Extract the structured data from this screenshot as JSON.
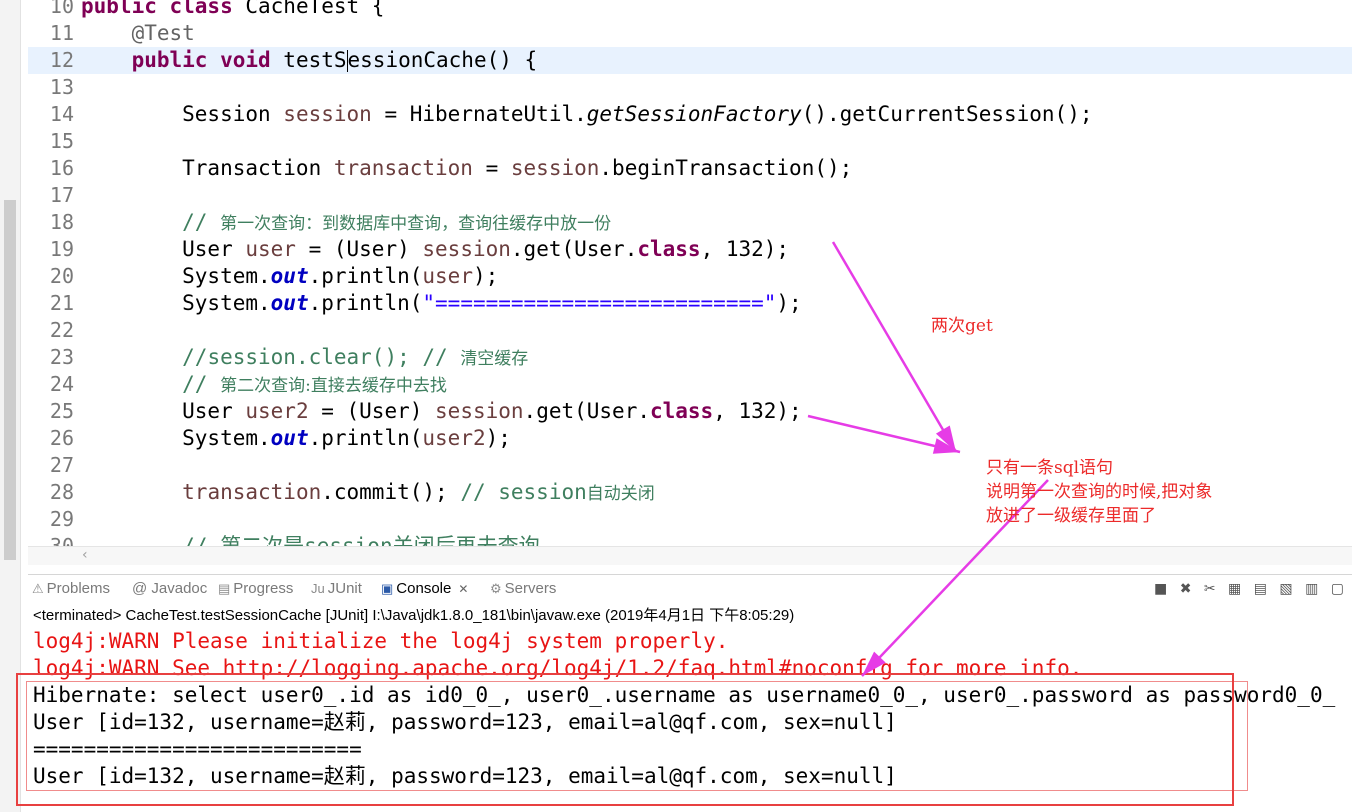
{
  "editor": {
    "lines": [
      {
        "no": "10",
        "segments": [
          {
            "t": "public class ",
            "c": "kw"
          },
          {
            "t": "CacheTest {",
            "c": ""
          }
        ]
      },
      {
        "no": "11",
        "fold": "⊖",
        "segments": [
          {
            "t": "    ",
            "c": ""
          },
          {
            "t": "@Test",
            "c": "ann"
          }
        ]
      },
      {
        "no": "12",
        "current": true,
        "segments": [
          {
            "t": "    ",
            "c": ""
          },
          {
            "t": "public void ",
            "c": "kw"
          },
          {
            "t": "testS",
            "c": ""
          },
          {
            "t": "",
            "c": "caret"
          },
          {
            "t": "essionCache() {",
            "c": ""
          }
        ]
      },
      {
        "no": "13",
        "segments": []
      },
      {
        "no": "14",
        "segments": [
          {
            "t": "        Session ",
            "c": ""
          },
          {
            "t": "session",
            "c": "var"
          },
          {
            "t": " = HibernateUtil.",
            "c": ""
          },
          {
            "t": "getSessionFactory",
            "c": "it"
          },
          {
            "t": "().getCurrentSession();",
            "c": ""
          }
        ]
      },
      {
        "no": "15",
        "segments": []
      },
      {
        "no": "16",
        "segments": [
          {
            "t": "        Transaction ",
            "c": ""
          },
          {
            "t": "transaction",
            "c": "var"
          },
          {
            "t": " = ",
            "c": ""
          },
          {
            "t": "session",
            "c": "var"
          },
          {
            "t": ".beginTransaction();",
            "c": ""
          }
        ]
      },
      {
        "no": "17",
        "segments": []
      },
      {
        "no": "18",
        "segments": [
          {
            "t": "        ",
            "c": ""
          },
          {
            "t": "// ",
            "c": "cm"
          },
          {
            "t": "第一次查询：到数据库中查询，查询往缓存中放一份",
            "c": "cmcjk"
          }
        ]
      },
      {
        "no": "19",
        "segments": [
          {
            "t": "        User ",
            "c": ""
          },
          {
            "t": "user",
            "c": "var"
          },
          {
            "t": " = (User) ",
            "c": ""
          },
          {
            "t": "session",
            "c": "var"
          },
          {
            "t": ".get(User.",
            "c": ""
          },
          {
            "t": "class",
            "c": "kw"
          },
          {
            "t": ", 132);",
            "c": ""
          }
        ]
      },
      {
        "no": "20",
        "segments": [
          {
            "t": "        System.",
            "c": ""
          },
          {
            "t": "out",
            "c": "fld"
          },
          {
            "t": ".println(",
            "c": ""
          },
          {
            "t": "user",
            "c": "var"
          },
          {
            "t": ");",
            "c": ""
          }
        ]
      },
      {
        "no": "21",
        "segments": [
          {
            "t": "        System.",
            "c": ""
          },
          {
            "t": "out",
            "c": "fld"
          },
          {
            "t": ".println(",
            "c": ""
          },
          {
            "t": "\"==========================\"",
            "c": "str"
          },
          {
            "t": ");",
            "c": ""
          }
        ]
      },
      {
        "no": "22",
        "segments": []
      },
      {
        "no": "23",
        "segments": [
          {
            "t": "        ",
            "c": ""
          },
          {
            "t": "//session.clear(); // ",
            "c": "cm"
          },
          {
            "t": "清空缓存",
            "c": "cmcjk"
          }
        ]
      },
      {
        "no": "24",
        "segments": [
          {
            "t": "        ",
            "c": ""
          },
          {
            "t": "// ",
            "c": "cm"
          },
          {
            "t": "第二次查询:直接去缓存中去找",
            "c": "cmcjk"
          }
        ]
      },
      {
        "no": "25",
        "segments": [
          {
            "t": "        User ",
            "c": ""
          },
          {
            "t": "user2",
            "c": "var"
          },
          {
            "t": " = (User) ",
            "c": ""
          },
          {
            "t": "session",
            "c": "var"
          },
          {
            "t": ".get(User.",
            "c": ""
          },
          {
            "t": "class",
            "c": "kw"
          },
          {
            "t": ", 132);",
            "c": ""
          }
        ]
      },
      {
        "no": "26",
        "segments": [
          {
            "t": "        System.",
            "c": ""
          },
          {
            "t": "out",
            "c": "fld"
          },
          {
            "t": ".println(",
            "c": ""
          },
          {
            "t": "user2",
            "c": "var"
          },
          {
            "t": ");",
            "c": ""
          }
        ]
      },
      {
        "no": "27",
        "segments": []
      },
      {
        "no": "28",
        "segments": [
          {
            "t": "        ",
            "c": ""
          },
          {
            "t": "transaction",
            "c": "var"
          },
          {
            "t": ".commit(); ",
            "c": ""
          },
          {
            "t": "// session",
            "c": "cm"
          },
          {
            "t": "自动关闭",
            "c": "cmcjk"
          }
        ]
      },
      {
        "no": "29",
        "segments": []
      },
      {
        "no": "30",
        "segments": [
          {
            "t": "        ",
            "c": ""
          },
          {
            "t": "// 第二次是session关闭后再去查询",
            "c": "cm"
          }
        ]
      }
    ],
    "scroll_left_glyph": "‹"
  },
  "tabs": [
    {
      "label": "Problems",
      "icon": "⚠",
      "name": "problems-tab"
    },
    {
      "label": "@ Javadoc",
      "icon": "",
      "name": "javadoc-tab"
    },
    {
      "label": "Progress",
      "icon": "▤",
      "name": "progress-tab"
    },
    {
      "label": "JUnit",
      "icon": "Ju",
      "name": "junit-tab"
    },
    {
      "label": "Console",
      "icon": "▣",
      "name": "console-tab",
      "active": true,
      "close": "✕"
    },
    {
      "label": "Servers",
      "icon": "⚙",
      "name": "servers-tab"
    }
  ],
  "toolbar_glyphs": "■ ✖ ✂ ▦ ▤ ▧ ▥ ▢",
  "console": {
    "header": "<terminated> CacheTest.testSessionCache [JUnit] I:\\Java\\jdk1.8.0_181\\bin\\javaw.exe (2019年4月1日 下午8:05:29)",
    "lines": [
      {
        "text": "log4j:WARN Please initialize the log4j system properly.",
        "kind": "err"
      },
      {
        "text": "log4j:WARN See http://logging.apache.org/log4j/1.2/faq.html#noconfig for more info.",
        "kind": "err"
      },
      {
        "text": "Hibernate: select user0_.id as id0_0_, user0_.username as username0_0_, user0_.password as password0_0_",
        "kind": "out"
      },
      {
        "text": "User [id=132, username=赵莉, password=123, email=al@qf.com, sex=null]",
        "kind": "out"
      },
      {
        "text": "==========================",
        "kind": "out"
      },
      {
        "text": "User [id=132, username=赵莉, password=123, email=al@qf.com, sex=null]",
        "kind": "out"
      }
    ]
  },
  "annotations": {
    "note1": "两次get",
    "note2": "只有一条sql语句\n说明第一次查询的时候,把对象\n放进了一级缓存里面了",
    "color": "#ec2a2a",
    "arrow_color": "#e63ce6"
  }
}
